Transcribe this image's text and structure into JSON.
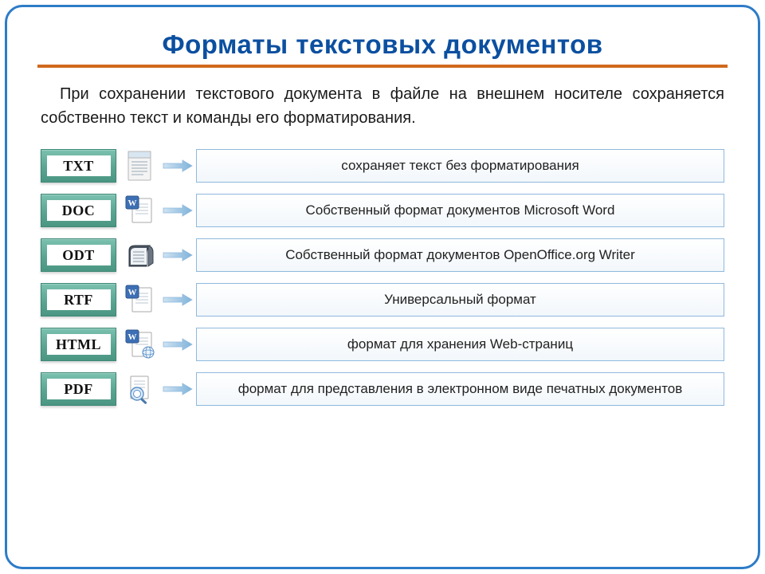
{
  "title": "Форматы текстовых документов",
  "intro": "При сохранении текстового документа в файле на внешнем носителе сохраняется собственно текст и команды его форматирования.",
  "formats": [
    {
      "label": "TXT",
      "desc": "сохраняет текст без форматирования",
      "icon": "txt"
    },
    {
      "label": "DOC",
      "desc": "Собственный формат документов Microsoft Word",
      "icon": "doc"
    },
    {
      "label": "ODT",
      "desc": "Собственный формат документов OpenOffice.org Writer",
      "icon": "odt"
    },
    {
      "label": "RTF",
      "desc": "Универсальный формат",
      "icon": "rtf"
    },
    {
      "label": "HTML",
      "desc": "формат для хранения Web-страниц",
      "icon": "html"
    },
    {
      "label": "PDF",
      "desc": "формат для представления в электронном виде печатных документов",
      "icon": "pdf"
    }
  ]
}
